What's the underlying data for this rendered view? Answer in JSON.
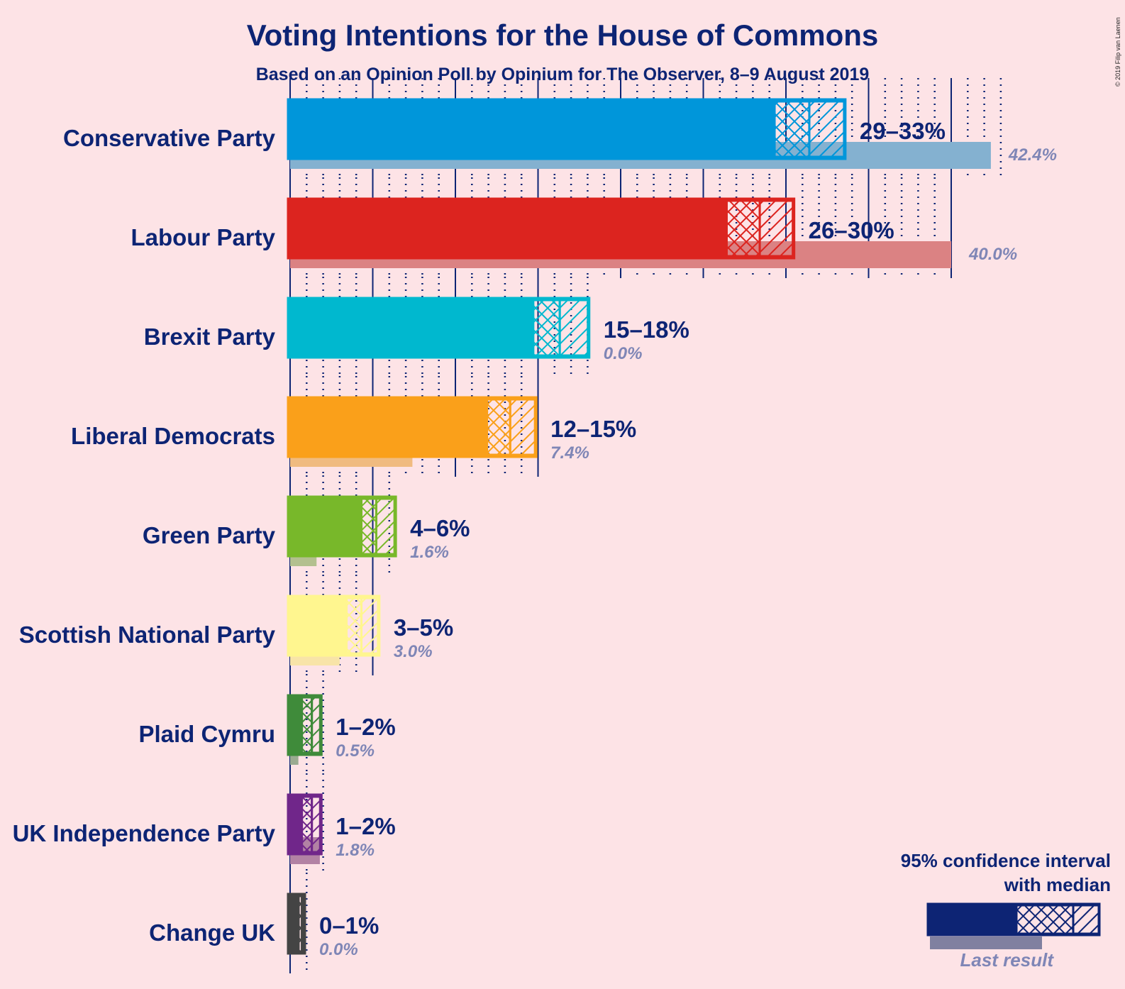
{
  "chart_data": {
    "type": "bar",
    "orientation": "horizontal",
    "title": "Voting Intentions for the House of Commons",
    "subtitle": "Based on an Opinion Poll by Opinium for The Observer, 8–9 August 2019",
    "copyright": "© 2019 Filip van Laenen",
    "xlim": [
      0,
      43
    ],
    "grid": true,
    "grid_major_step": 5,
    "grid_minor_step": 1,
    "legend_position": "bottom-right",
    "legend": {
      "line1": "95% confidence interval",
      "line2": "with median",
      "last_result": "Last result",
      "color": "#0d2474",
      "last_color": "#8080a0"
    },
    "parties": [
      {
        "name": "Conservative Party",
        "low": 29.1,
        "median": 31.2,
        "high": 33.3,
        "range_label": "29–33%",
        "last": 42.4,
        "last_label": "42.4%",
        "color": "#0096da",
        "last_color": "#84b1d0"
      },
      {
        "name": "Labour Party",
        "low": 26.2,
        "median": 28.2,
        "high": 30.2,
        "range_label": "26–30%",
        "last": 40.0,
        "last_label": "40.0%",
        "color": "#dc241f",
        "last_color": "#db8283"
      },
      {
        "name": "Brexit Party",
        "low": 14.5,
        "median": 16.1,
        "high": 17.8,
        "range_label": "15–18%",
        "last": 0.0,
        "last_label": "0.0%",
        "color": "#00b8cf",
        "last_color": "#80c8d8"
      },
      {
        "name": "Liberal Democrats",
        "low": 11.7,
        "median": 13.1,
        "high": 14.6,
        "range_label": "12–15%",
        "last": 7.4,
        "last_label": "7.4%",
        "color": "#faa01a",
        "last_color": "#f0bb80"
      },
      {
        "name": "Green Party",
        "low": 4.1,
        "median": 5.0,
        "high": 6.1,
        "range_label": "4–6%",
        "last": 1.6,
        "last_label": "1.6%",
        "color": "#78b82a",
        "last_color": "#b3c08f"
      },
      {
        "name": "Scottish National Party",
        "low": 3.2,
        "median": 4.1,
        "high": 5.1,
        "range_label": "3–5%",
        "last": 3.0,
        "last_label": "3.0%",
        "color": "#fff68f",
        "last_color": "#f8e4a8"
      },
      {
        "name": "Plaid Cymru",
        "low": 0.5,
        "median": 1.1,
        "high": 1.6,
        "range_label": "1–2%",
        "last": 0.5,
        "last_label": "0.5%",
        "color": "#3f8b3a",
        "last_color": "#9bab91"
      },
      {
        "name": "UK Independence Party",
        "low": 0.5,
        "median": 1.1,
        "high": 1.6,
        "range_label": "1–2%",
        "last": 1.8,
        "last_label": "1.8%",
        "color": "#70268a",
        "last_color": "#b282a4"
      },
      {
        "name": "Change UK",
        "low": 0.3,
        "median": 0.5,
        "high": 0.6,
        "range_label": "0–1%",
        "last": 0.0,
        "last_label": "0.0%",
        "color": "#444444",
        "last_color": "#999999"
      }
    ]
  }
}
